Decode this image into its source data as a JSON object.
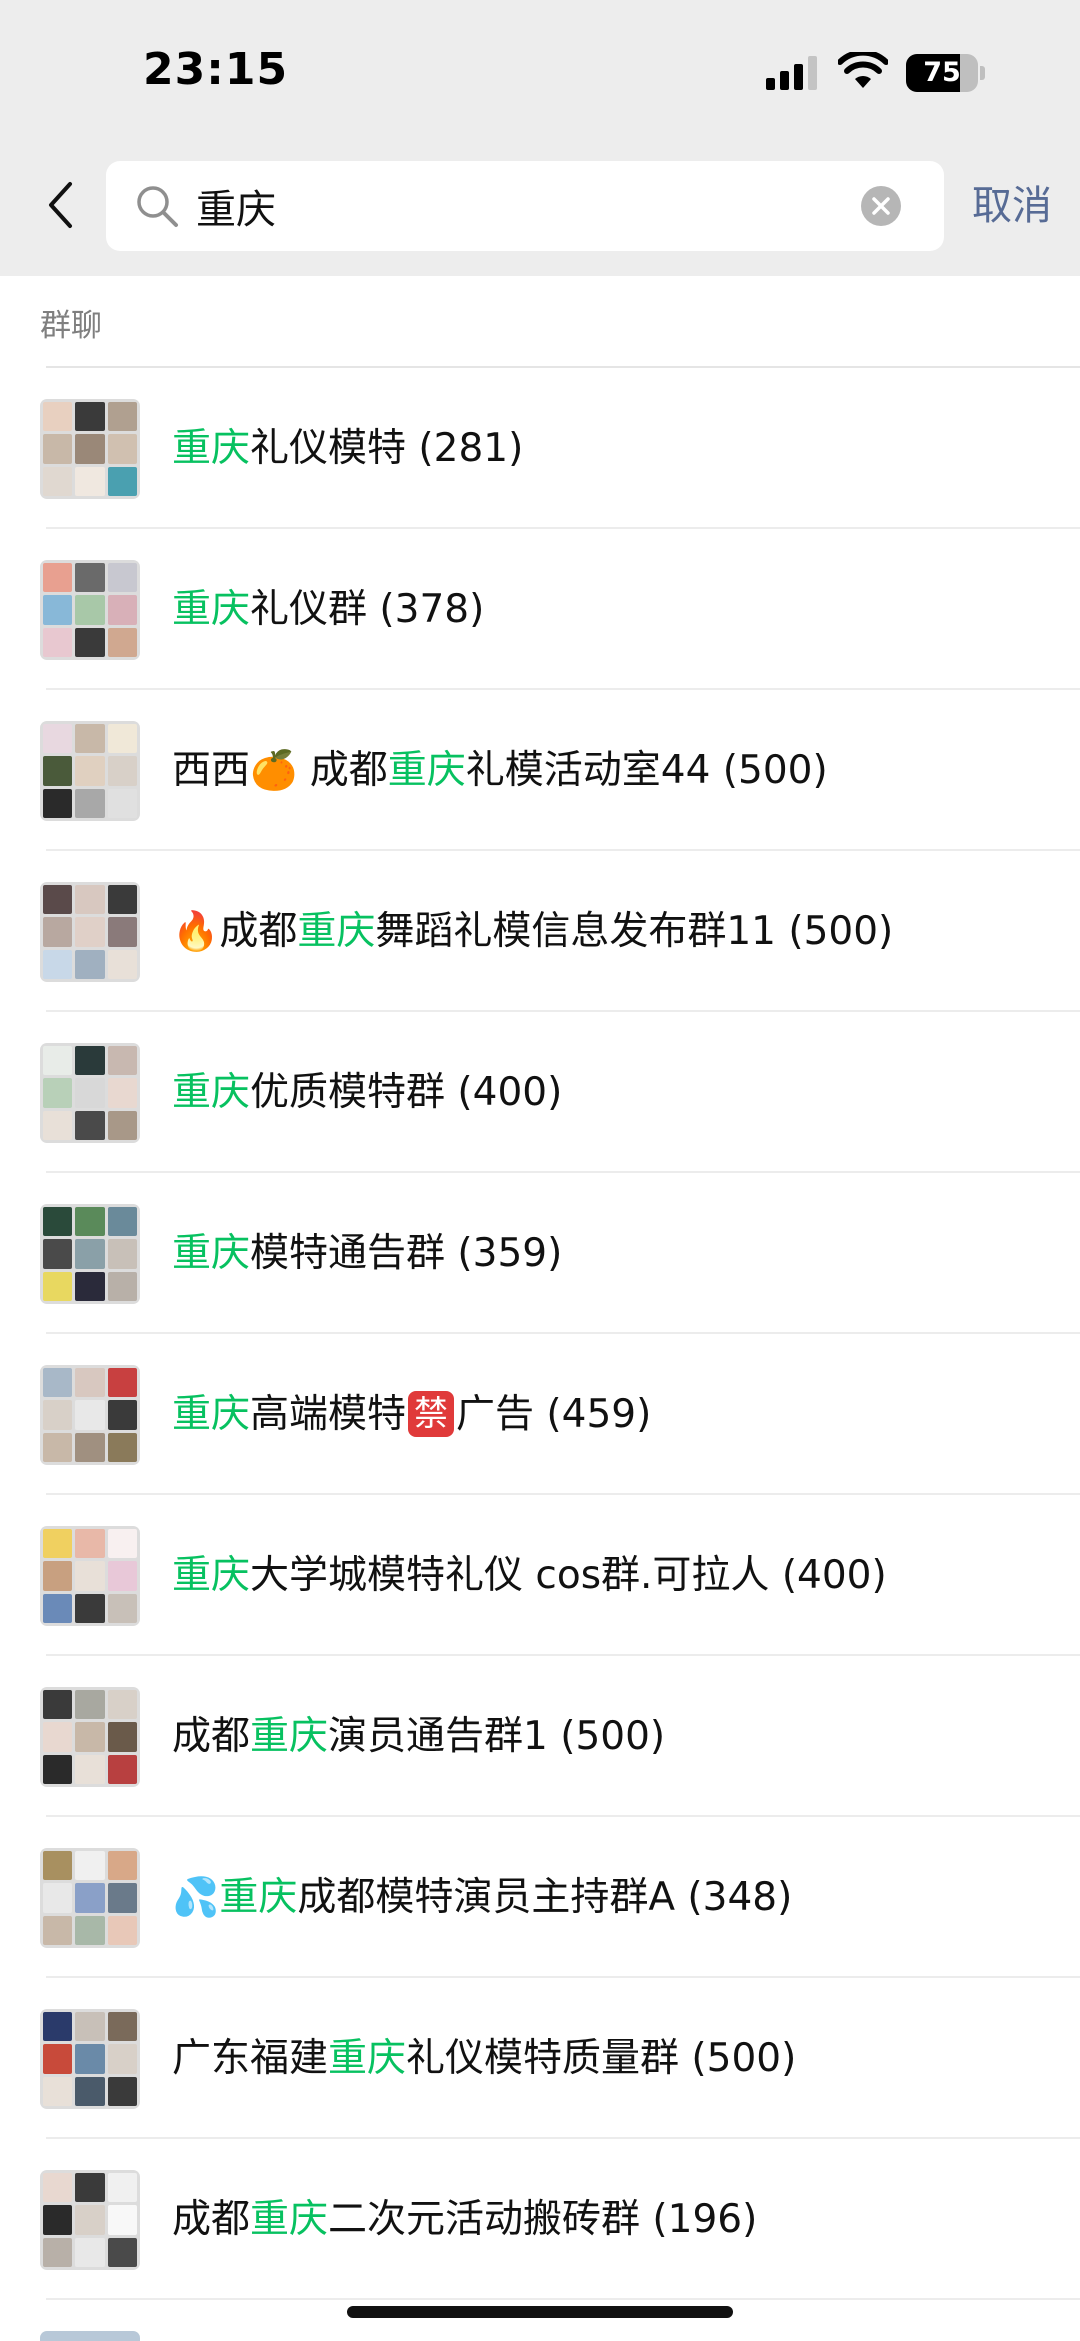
{
  "status_bar": {
    "time": "23:15",
    "battery_level": "75",
    "battery_fraction": 0.75
  },
  "search": {
    "query": "重庆",
    "cancel_label": "取消"
  },
  "section": {
    "title": "群聊"
  },
  "highlight_color": "#07c160",
  "results": [
    {
      "parts": [
        {
          "text": "重庆",
          "hl": true
        },
        {
          "text": "礼仪模特 (281)"
        }
      ],
      "avatar": [
        "#e8d0c0",
        "#3a3a3a",
        "#b0a090",
        "#c8b8a8",
        "#9a8878",
        "#d0c0b0",
        "#e0d8d0",
        "#f0e8e0",
        "#4aa0b0"
      ]
    },
    {
      "parts": [
        {
          "text": "重庆",
          "hl": true
        },
        {
          "text": "礼仪群 (378)"
        }
      ],
      "avatar": [
        "#e8a090",
        "#6a6a6a",
        "#c8c8d0",
        "#88b8d8",
        "#a8c8a8",
        "#d8b0b8",
        "#e8c8d0",
        "#3a3a3a",
        "#d0a890"
      ]
    },
    {
      "parts": [
        {
          "text": "西西"
        },
        {
          "text": "🍊",
          "emoji": true
        },
        {
          "text": " 成都"
        },
        {
          "text": "重庆",
          "hl": true
        },
        {
          "text": "礼模活动室44 (500)"
        }
      ],
      "avatar": [
        "#e8d8e0",
        "#c8b8a8",
        "#f0e8d8",
        "#4a5a3a",
        "#e0d0c0",
        "#d8d0c8",
        "#2a2a2a",
        "#a8a8a8",
        "#e0e0e0"
      ]
    },
    {
      "parts": [
        {
          "text": "🔥",
          "emoji": true
        },
        {
          "text": "成都"
        },
        {
          "text": "重庆",
          "hl": true
        },
        {
          "text": "舞蹈礼模信息发布群11 (500)"
        }
      ],
      "avatar": [
        "#5a4a4a",
        "#d8c8c0",
        "#3a3a3a",
        "#b8a8a0",
        "#e0d0c8",
        "#8a7a7a",
        "#c8d8e8",
        "#a0b0c0",
        "#e8e0d8"
      ]
    },
    {
      "parts": [
        {
          "text": "重庆",
          "hl": true
        },
        {
          "text": "优质模特群 (400)"
        }
      ],
      "avatar": [
        "#e8ece8",
        "#2a3a3a",
        "#c8b8b0",
        "#b8d0b8",
        "#d8d8d8",
        "#e8d8d0",
        "#e8e0d8",
        "#4a4a4a",
        "#a89888"
      ]
    },
    {
      "parts": [
        {
          "text": "重庆",
          "hl": true
        },
        {
          "text": "模特通告群 (359)"
        }
      ],
      "avatar": [
        "#2a4a3a",
        "#5a8a5a",
        "#6a8a9a",
        "#4a4a4a",
        "#8aa0a8",
        "#c8c0b8",
        "#e8d860",
        "#2a2a3a",
        "#b8b0a8"
      ]
    },
    {
      "parts": [
        {
          "text": "重庆",
          "hl": true
        },
        {
          "text": "高端模特"
        },
        {
          "text": "禁",
          "forbid": true
        },
        {
          "text": "广告 (459)"
        }
      ],
      "avatar": [
        "#a8b8c8",
        "#d8c8c0",
        "#c84040",
        "#d8d0c8",
        "#e8e8e8",
        "#3a3a3a",
        "#c8b8a8",
        "#a09080",
        "#8a7a5a"
      ]
    },
    {
      "parts": [
        {
          "text": "重庆",
          "hl": true
        },
        {
          "text": "大学城模特礼仪 cos群.可拉人 (400)"
        }
      ],
      "avatar": [
        "#f0d060",
        "#e8b8a8",
        "#f8f0f0",
        "#c8a080",
        "#e8e0d8",
        "#e8c8d8",
        "#6a8ab8",
        "#3a3a3a",
        "#c8c0b8"
      ]
    },
    {
      "parts": [
        {
          "text": "成都"
        },
        {
          "text": "重庆",
          "hl": true
        },
        {
          "text": "演员通告群1 (500)"
        }
      ],
      "avatar": [
        "#3a3a3a",
        "#a8a8a0",
        "#d8d0c8",
        "#e8d8d0",
        "#c8b8a8",
        "#6a5a4a",
        "#2a2a2a",
        "#e8e0d8",
        "#b84040"
      ]
    },
    {
      "parts": [
        {
          "text": "💦",
          "emoji": true
        },
        {
          "text": "重庆",
          "hl": true
        },
        {
          "text": "成都模特演员主持群A (348)"
        }
      ],
      "avatar": [
        "#a89060",
        "#f0f0f0",
        "#d8a888",
        "#e8e8e8",
        "#8aa0c8",
        "#6a7a8a",
        "#c8b8a8",
        "#a8b8a8",
        "#e8c8b8"
      ]
    },
    {
      "parts": [
        {
          "text": "广东福建"
        },
        {
          "text": "重庆",
          "hl": true
        },
        {
          "text": "礼仪模特质量群 (500)"
        }
      ],
      "avatar": [
        "#2a3a6a",
        "#c8c0b8",
        "#7a6a5a",
        "#c84a3a",
        "#6a8aa8",
        "#d8d0c8",
        "#e8e0d8",
        "#4a5a6a",
        "#3a3a3a"
      ]
    },
    {
      "parts": [
        {
          "text": "成都"
        },
        {
          "text": "重庆",
          "hl": true
        },
        {
          "text": "二次元活动搬砖群 (196)"
        }
      ],
      "avatar": [
        "#e8d8d0",
        "#3a3a3a",
        "#f0f0f0",
        "#2a2a2a",
        "#d8d0c8",
        "#f8f8f8",
        "#b8b0a8",
        "#e8e8e8",
        "#4a4a4a"
      ]
    }
  ]
}
